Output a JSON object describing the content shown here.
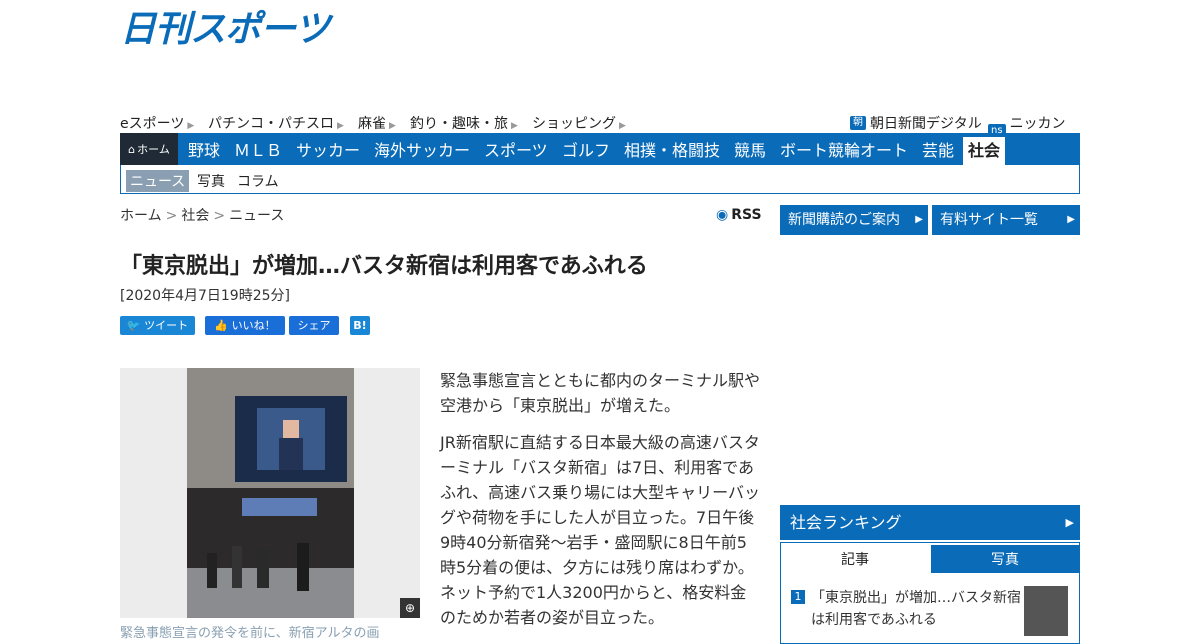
{
  "logo": "日刊スポーツ",
  "subnav": {
    "items": [
      "eスポーツ",
      "パチンコ・パチスロ",
      "麻雀",
      "釣り・趣味・旅",
      "ショッピング"
    ],
    "right": [
      {
        "badge": "朝",
        "label": "朝日新聞デジタル"
      },
      {
        "badge": "ns",
        "label": "ニッカンID"
      }
    ]
  },
  "mainnav": {
    "home": "ホーム",
    "items": [
      "野球",
      "ＭＬＢ",
      "サッカー",
      "海外サッカー",
      "スポーツ",
      "ゴルフ",
      "相撲・格闘技",
      "競馬",
      "ボート競輪オート",
      "芸能"
    ],
    "active": "社会"
  },
  "thirdnav": {
    "selected": "ニュース",
    "items": [
      "写真",
      "コラム"
    ]
  },
  "breadcrumb": {
    "home": "ホーム",
    "section": "社会",
    "current": "ニュース",
    "sep": ">"
  },
  "rss": "RSS",
  "side_buttons": [
    "新聞購読のご案内",
    "有料サイト一覧"
  ],
  "article": {
    "title": "「東京脱出」が増加…バスタ新宿は利用客であふれる",
    "date": "[2020年4月7日19時25分]",
    "share": {
      "tweet": "ツイート",
      "like": "いいね！",
      "share": "シェア",
      "hatena": "B!"
    },
    "caption": "緊急事態宣言の発令を前に、新宿アルタの画",
    "paragraphs": [
      "緊急事態宣言とともに都内のターミナル駅や空港から「東京脱出」が増えた。",
      "JR新宿駅に直結する日本最大級の高速バスターミナル「バスタ新宿」は7日、利用客であふれ、高速バス乗り場には大型キャリーバッグや荷物を手にした人が目立った。7日午後9時40分新宿発～岩手・盛岡駅に8日午前5時5分着の便は、夕方には残り席はわずか。ネット予約で1人3200円からと、格安料金のためか若者の姿が目立った。"
    ]
  },
  "ranking": {
    "title": "社会ランキング",
    "tabs": [
      "記事",
      "写真"
    ],
    "items": [
      {
        "rank": "1",
        "text": "「東京脱出」が増加…バスタ新宿は利用客であふれる"
      }
    ]
  }
}
